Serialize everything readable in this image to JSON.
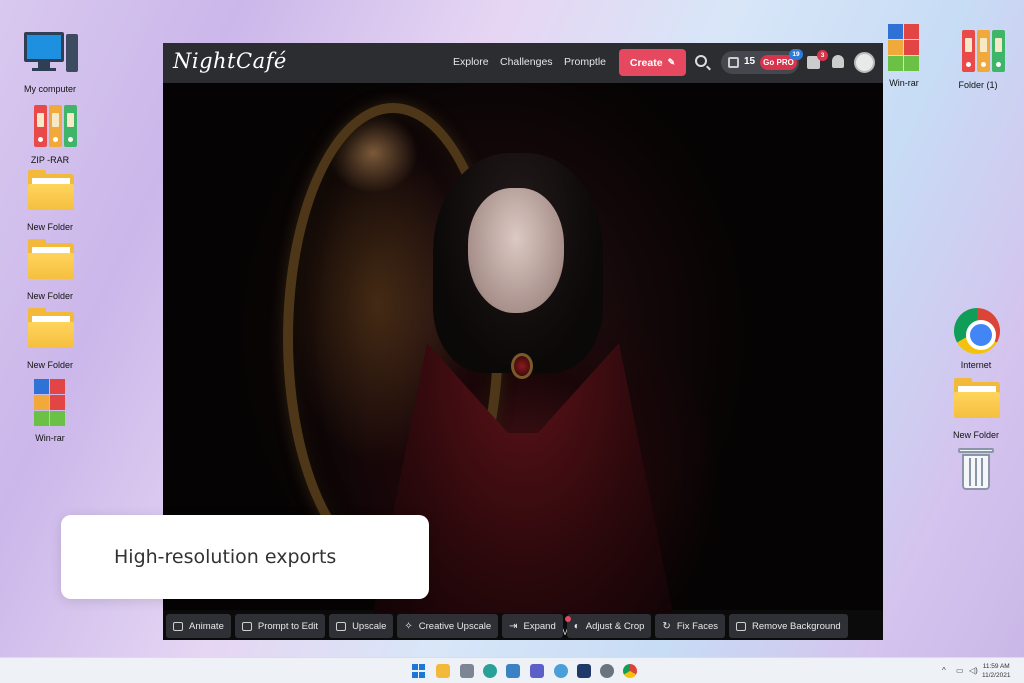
{
  "desktop": {
    "icons_left": [
      {
        "label": "My computer"
      },
      {
        "label": "ZIP -RAR"
      },
      {
        "label": "New Folder"
      },
      {
        "label": "New Folder"
      },
      {
        "label": "New Folder"
      },
      {
        "label": "Win-rar"
      }
    ],
    "icons_right": [
      {
        "label": "Win-rar"
      },
      {
        "label": "Folder (1)"
      },
      {
        "label": "Internet"
      },
      {
        "label": "New Folder"
      }
    ]
  },
  "app": {
    "logo": "NightCafé",
    "nav": [
      "Explore",
      "Challenges",
      "Promptle"
    ],
    "create_label": "Create",
    "credits_count": "15",
    "go_pro_label": "Go PRO",
    "go_pro_badge": "19",
    "dice_badge": "3",
    "more_label": "More",
    "actions": [
      "Animate",
      "Prompt to Edit",
      "Upscale",
      "Creative Upscale",
      "Expand",
      "Adjust & Crop",
      "Fix Faces",
      "Remove Background"
    ]
  },
  "callout": "High-resolution exports",
  "taskbar": {
    "time": "11:59 AM",
    "date": "11/2/2021"
  },
  "colors": {
    "create_button": "#e5485f",
    "go_pro": "#d8344b",
    "topbar": "#2b2d31"
  }
}
